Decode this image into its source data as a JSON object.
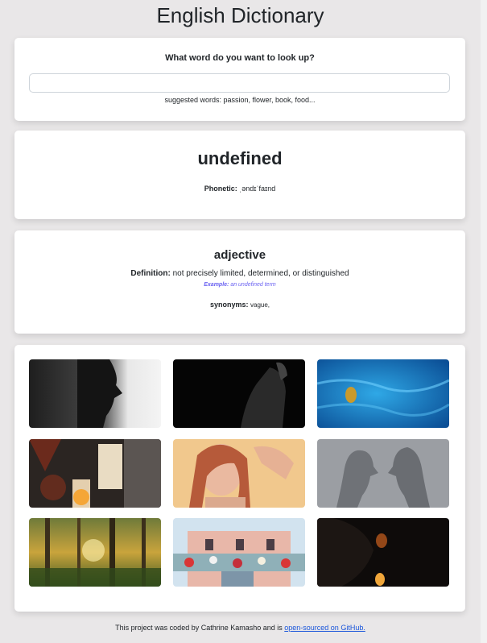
{
  "page": {
    "title": "English Dictionary"
  },
  "search": {
    "question": "What word do you want to look up?",
    "value": "",
    "placeholder": "",
    "suggested": "suggested words: passion, flower, book, food..."
  },
  "word": {
    "title": "undefined",
    "phonetic_label": "Phonetic:",
    "phonetic": "ˌəndɪˈfaɪnd"
  },
  "meaning": {
    "part_of_speech": "adjective",
    "definition_label": "Definition:",
    "definition": "not precisely limited, determined, or distinguished",
    "example_label": "Example:",
    "example": "an undefined term",
    "synonyms_label": "synonyms:",
    "synonyms": "vague,"
  },
  "photos": [
    {
      "name": "silhouette-profile-photo"
    },
    {
      "name": "dark-figure-photo"
    },
    {
      "name": "underwater-blue-photo"
    },
    {
      "name": "candles-photo"
    },
    {
      "name": "woman-eyes-closed-photo"
    },
    {
      "name": "shadow-profiles-photo"
    },
    {
      "name": "forest-sunlight-photo"
    },
    {
      "name": "flowers-building-photo"
    },
    {
      "name": "dark-candle-glow-photo"
    }
  ],
  "footer": {
    "text": "This project was coded by Cathrine Kamasho and is ",
    "link": "open-sourced on GitHub."
  },
  "colors": {
    "background": "#e9e7e8",
    "card": "#ffffff",
    "example": "#6b63f2",
    "link": "#1a56db"
  }
}
